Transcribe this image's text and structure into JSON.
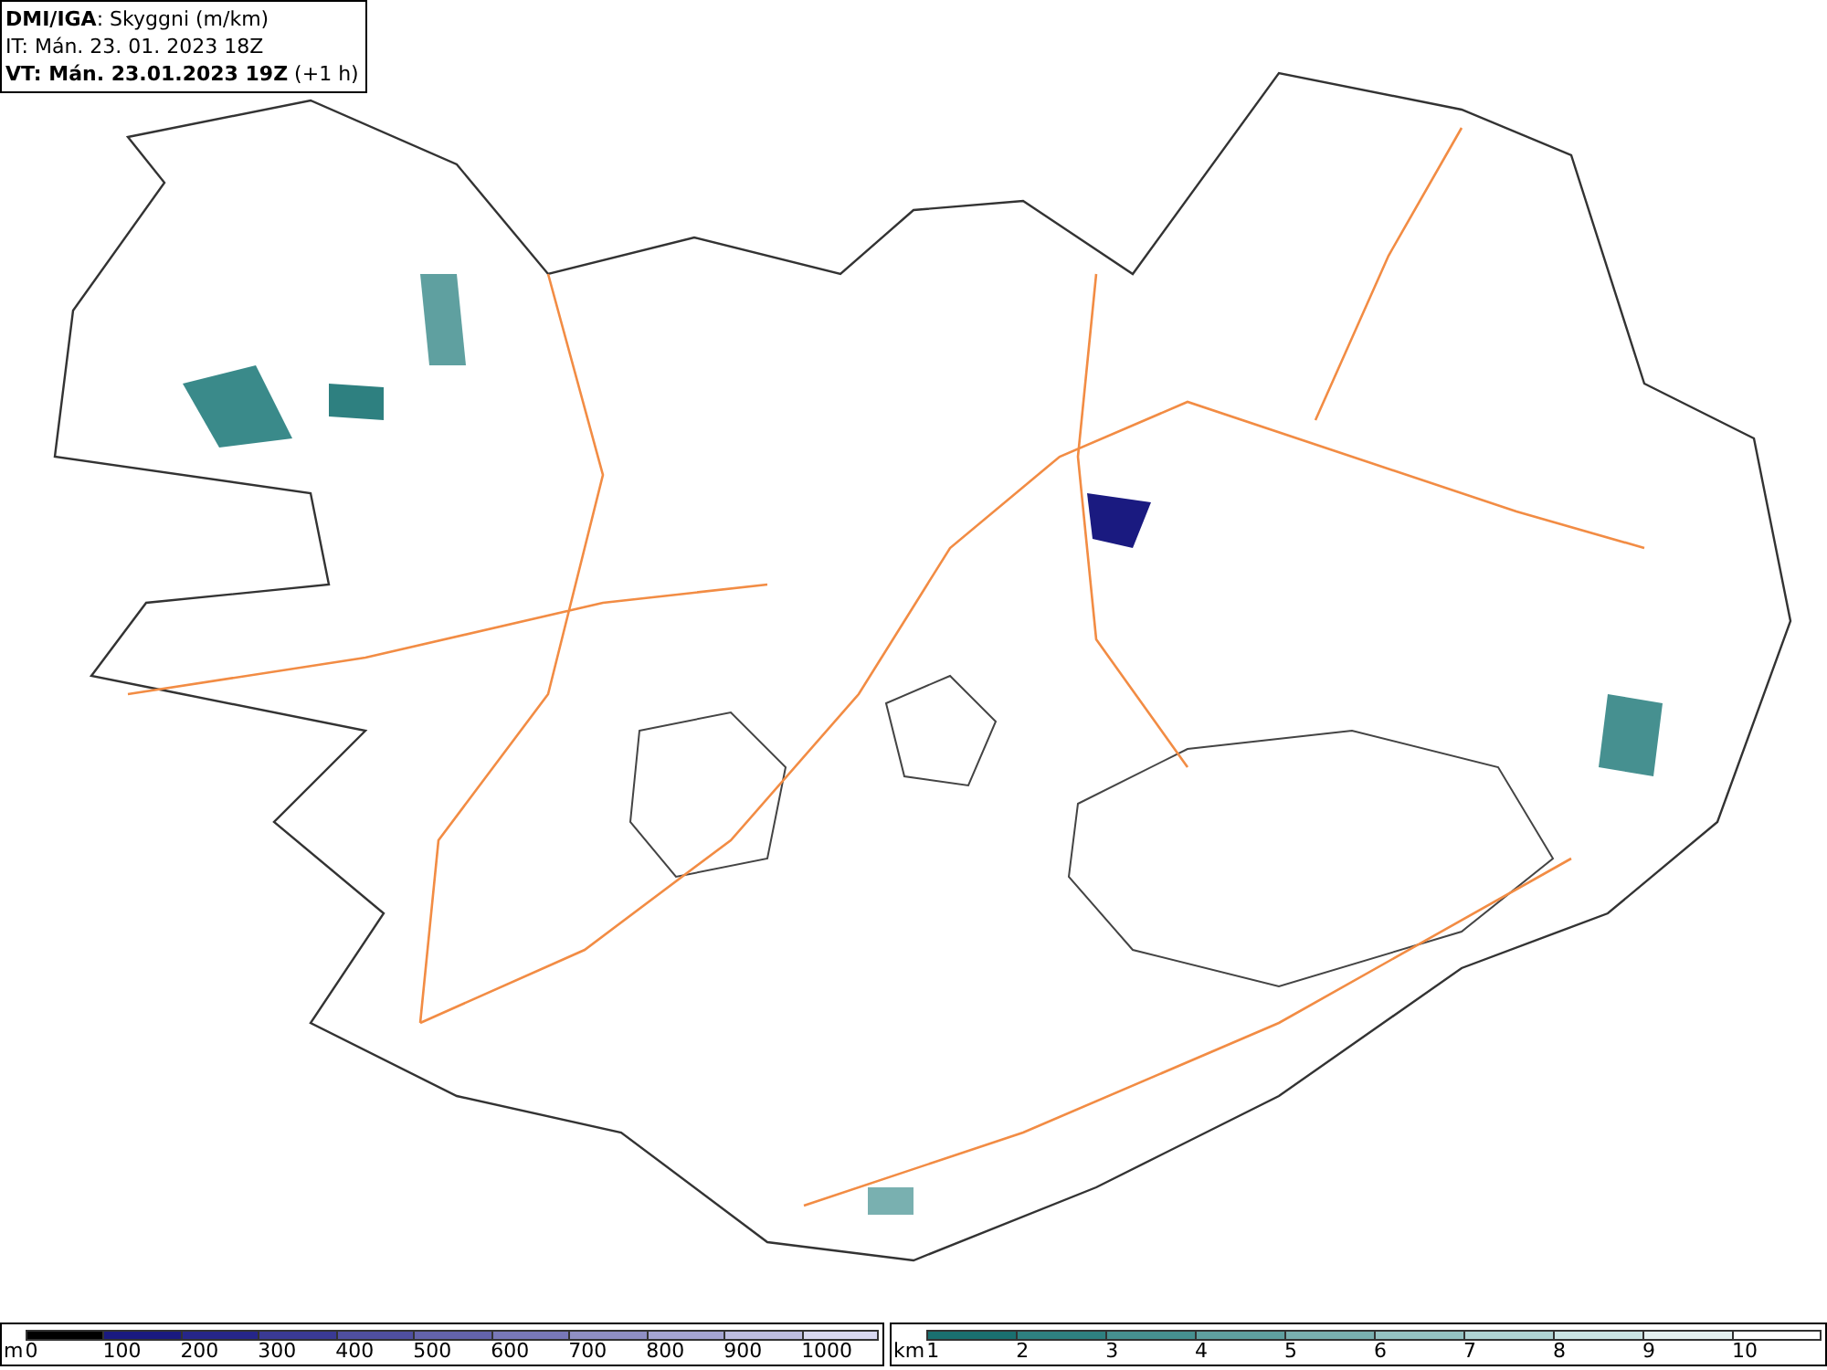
{
  "header": {
    "lines": [
      "**DMI/IGA**: Skyggni (m/km)",
      "IT: Mán. 23. 01. 2023 18Z",
      "**VT: Mán. 23.01.2023 19Z** (+1 h)"
    ]
  },
  "legends": [
    {
      "unit": "m",
      "bins": [
        {
          "color": "#000000",
          "label": "0"
        },
        {
          "color": "#1a1a80",
          "label": "100"
        },
        {
          "color": "#26268a",
          "label": "200"
        },
        {
          "color": "#3a3a94",
          "label": "300"
        },
        {
          "color": "#4f4fa0",
          "label": "400"
        },
        {
          "color": "#6363ab",
          "label": "500"
        },
        {
          "color": "#7878b8",
          "label": "600"
        },
        {
          "color": "#8f8fc4",
          "label": "700"
        },
        {
          "color": "#a5a5d2",
          "label": "800"
        },
        {
          "color": "#bdbde0",
          "label": "900"
        },
        {
          "color": "#d8d8f0",
          "label": "1000"
        }
      ]
    },
    {
      "unit": "km",
      "bins": [
        {
          "color": "#1a7070",
          "label": "1"
        },
        {
          "color": "#2e8080",
          "label": "2"
        },
        {
          "color": "#469090",
          "label": "3"
        },
        {
          "color": "#5fa0a0",
          "label": "4"
        },
        {
          "color": "#79b0b0",
          "label": "5"
        },
        {
          "color": "#94c2c2",
          "label": "6"
        },
        {
          "color": "#afd3d3",
          "label": "7"
        },
        {
          "color": "#cae4e4",
          "label": "8"
        },
        {
          "color": "#e4f1f1",
          "label": "9"
        },
        {
          "color": "#ffffff",
          "label": "10"
        }
      ]
    }
  ]
}
